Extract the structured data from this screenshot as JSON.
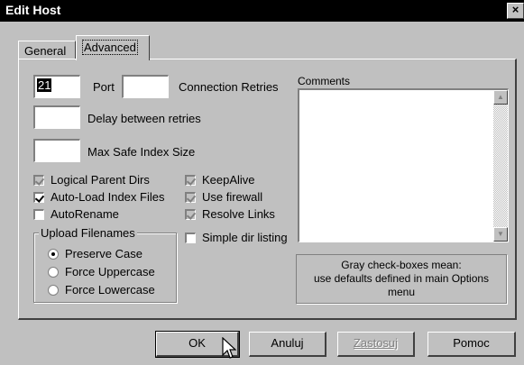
{
  "window": {
    "title": "Edit Host",
    "close_glyph": "×"
  },
  "tabs": [
    {
      "label": "General"
    },
    {
      "label": "Advanced",
      "active": true
    }
  ],
  "fields": {
    "port": {
      "value": "21",
      "label": "Port"
    },
    "connection_retries": {
      "value": "",
      "label": "Connection Retries"
    },
    "delay": {
      "value": "",
      "label": "Delay between retries"
    },
    "max_safe_index": {
      "value": "",
      "label": "Max Safe Index Size"
    }
  },
  "comments": {
    "label": "Comments",
    "value": ""
  },
  "checkboxes_left": [
    {
      "label": "Logical Parent Dirs",
      "checked": true,
      "gray": true
    },
    {
      "label": "Auto-Load Index Files",
      "checked": true,
      "gray": false
    },
    {
      "label": "AutoRename",
      "checked": false,
      "gray": false
    }
  ],
  "checkboxes_right": [
    {
      "label": "KeepAlive",
      "checked": true,
      "gray": true
    },
    {
      "label": "Use firewall",
      "checked": true,
      "gray": true
    },
    {
      "label": "Resolve Links",
      "checked": true,
      "gray": true
    },
    {
      "label": "Simple dir listing",
      "checked": false,
      "gray": false
    }
  ],
  "upload_filenames": {
    "title": "Upload Filenames",
    "options": [
      {
        "label": "Preserve Case",
        "checked": true
      },
      {
        "label": "Force Uppercase",
        "checked": false
      },
      {
        "label": "Force Lowercase",
        "checked": false
      }
    ]
  },
  "info": {
    "line1": "Gray check-boxes mean:",
    "line2": "use defaults defined in main Options",
    "line3": "menu"
  },
  "buttons": {
    "ok": "OK",
    "cancel": "Anuluj",
    "apply": "Zastosuj",
    "help": "Pomoc"
  },
  "colors": {
    "face": "#c0c0c0",
    "titlebar": "#000000",
    "highlight": "#ffffff",
    "shadow": "#808080"
  },
  "icons": {
    "scroll_up": "scroll-up-arrow",
    "scroll_down": "scroll-down-arrow",
    "pointer": "mouse-pointer"
  }
}
